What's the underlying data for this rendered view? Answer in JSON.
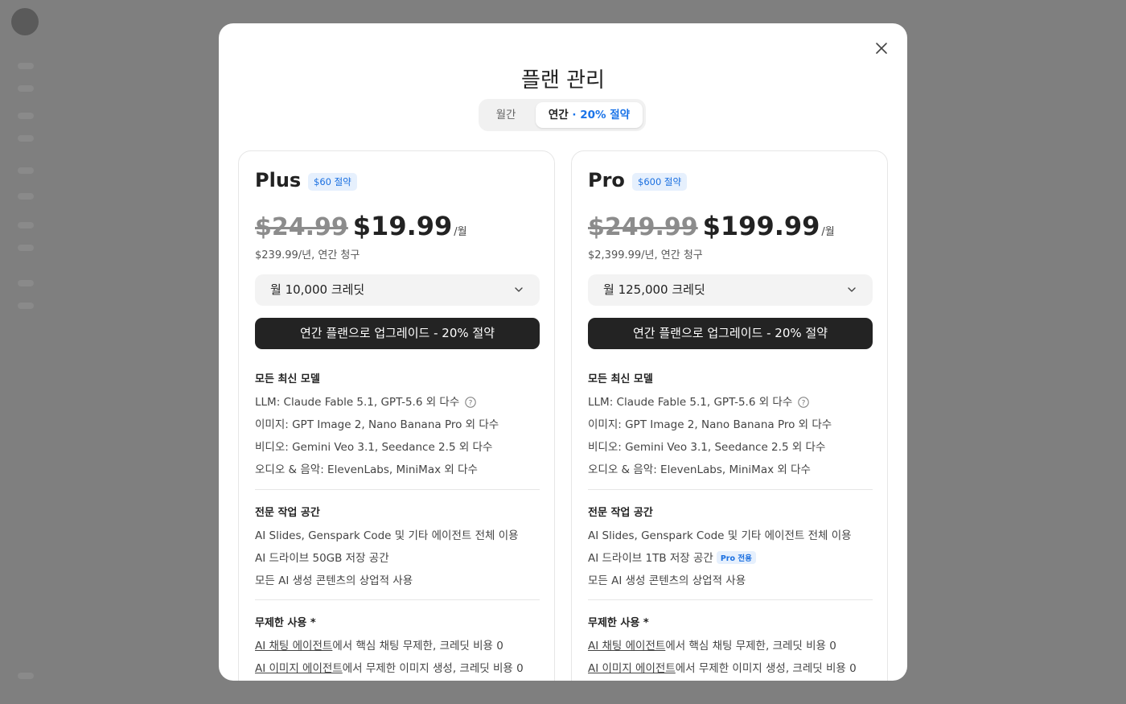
{
  "modal": {
    "title": "플랜 관리"
  },
  "billing_toggle": {
    "monthly_label": "월간",
    "yearly_label": "연간",
    "yearly_save": "· 20% 절약",
    "selected": "yearly"
  },
  "plans": [
    {
      "name": "Plus",
      "badge": "$60 절약",
      "old_price": "$24.99",
      "price": "$19.99",
      "per": "/월",
      "billing_note": "$239.99/년, 연간 청구",
      "credits": "월 10,000 크레딧",
      "upgrade_label": "연간 플랜으로 업그레이드 - 20% 절약",
      "models_title": "모든 최신 모델",
      "models": [
        "LLM: Claude Fable 5.1, GPT-5.6 외 다수",
        "이미지: GPT Image 2, Nano Banana Pro 외 다수",
        "비디오: Gemini Veo 3.1, Seedance 2.5 외 다수",
        "오디오 & 음악: ElevenLabs, MiniMax 외 다수"
      ],
      "workspace_title": "전문 작업 공간",
      "workspace": [
        "AI Slides, Genspark Code 및 기타 에이전트 전체 이용",
        "AI 드라이브 50GB 저장 공간",
        "모든 AI 생성 콘텐츠의 상업적 사용"
      ],
      "unlimited_title": "무제한 사용 *",
      "unlimited": [
        {
          "link": "AI 채팅 에이전트",
          "text": "에서 핵심 채팅 무제한, 크레딧 비용 0"
        },
        {
          "link": "AI 이미지 에이전트",
          "text": "에서 무제한 이미지 생성, 크레딧 비용 0"
        }
      ]
    },
    {
      "name": "Pro",
      "badge": "$600 절약",
      "old_price": "$249.99",
      "price": "$199.99",
      "per": "/월",
      "billing_note": "$2,399.99/년, 연간 청구",
      "credits": "월 125,000 크레딧",
      "upgrade_label": "연간 플랜으로 업그레이드 - 20% 절약",
      "models_title": "모든 최신 모델",
      "models": [
        "LLM: Claude Fable 5.1, GPT-5.6 외 다수",
        "이미지: GPT Image 2, Nano Banana Pro 외 다수",
        "비디오: Gemini Veo 3.1, Seedance 2.5 외 다수",
        "오디오 & 음악: ElevenLabs, MiniMax 외 다수"
      ],
      "workspace_title": "전문 작업 공간",
      "workspace": [
        "AI Slides, Genspark Code 및 기타 에이전트 전체 이용",
        "AI 드라이브 1TB 저장 공간",
        "모든 AI 생성 콘텐츠의 상업적 사용"
      ],
      "pro_only_badge": "Pro 전용",
      "unlimited_title": "무제한 사용 *",
      "unlimited": [
        {
          "link": "AI 채팅 에이전트",
          "text": "에서 핵심 채팅 무제한, 크레딧 비용 0"
        },
        {
          "link": "AI 이미지 에이전트",
          "text": "에서 무제한 이미지 생성, 크레딧 비용 0"
        }
      ]
    }
  ],
  "icons": {
    "close": "close-icon",
    "chevron": "chevron-down-icon",
    "help": "help-circle-icon"
  },
  "colors": {
    "accent": "#1a73e8",
    "badge_bg": "#e6f0fd",
    "button_dark": "#232323",
    "overlay": "#7f7f7f"
  }
}
